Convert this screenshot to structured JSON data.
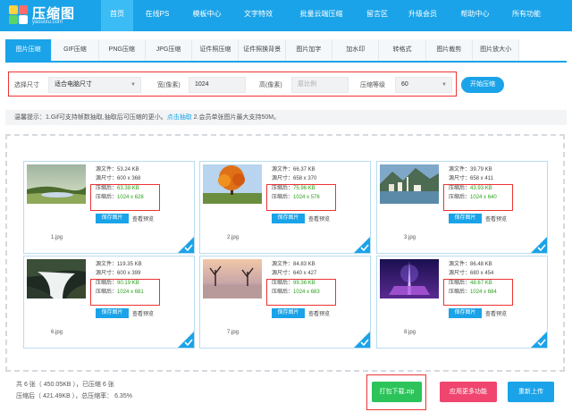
{
  "brand": {
    "name": "压缩图",
    "domain": "yasuotu.com"
  },
  "colors": {
    "primary": "#1aa3e8",
    "green": "#2ca01c",
    "pink": "#f0456f",
    "highlight": "#e33333"
  },
  "nav": [
    "首页",
    "在线PS",
    "模板中心",
    "文字特效",
    "批量云端压缩",
    "留言区",
    "升级会员",
    "帮助中心",
    "所有功能"
  ],
  "tabs": [
    "图片压缩",
    "GIF压缩",
    "PNG压缩",
    "JPG压缩",
    "证件照压缩",
    "证件照换背景",
    "图片加字",
    "加水印",
    "转格式",
    "图片裁剪",
    "图片放大小"
  ],
  "options": {
    "size_label": "选择尺寸",
    "size_value": "适合电脑尺寸",
    "width_label": "宽(像素)",
    "width_value": "1024",
    "height_label": "高(像素)",
    "height_placeholder": "原比例",
    "level_label": "压缩等级",
    "level_value": "60",
    "start_button": "开始压缩"
  },
  "tip": {
    "prefix": "温馨提示：1.Gif可支持帧数抽取,抽取后可压缩的更小。",
    "link": "点击抽取",
    "suffix": " 2.会员单张图片最大支持50M。"
  },
  "labels": {
    "src_size": "源文件：",
    "src_dim": "源尺寸：",
    "after_size": "压缩后：",
    "after_dim": "压缩后：",
    "save": "保存图片",
    "preview": "查看预览"
  },
  "images": [
    {
      "name": "1.jpg",
      "src_size": "53.24 KB",
      "src_dim": "600 x 368",
      "out_size": "63.38 KB",
      "out_dim": "1024 x 628"
    },
    {
      "name": "2.jpg",
      "src_size": "66.37 KB",
      "src_dim": "658 x 370",
      "out_size": "75.96 KB",
      "out_dim": "1024 x 576"
    },
    {
      "name": "3.jpg",
      "src_size": "39.79 KB",
      "src_dim": "658 x 411",
      "out_size": "43.93 KB",
      "out_dim": "1024 x 640"
    },
    {
      "name": "6.jpg",
      "src_size": "119.35 KB",
      "src_dim": "600 x 399",
      "out_size": "90.19 KB",
      "out_dim": "1024 x 681"
    },
    {
      "name": "7.jpg",
      "src_size": "84.83 KB",
      "src_dim": "640 x 427",
      "out_size": "99.36 KB",
      "out_dim": "1024 x 683"
    },
    {
      "name": "8.jpg",
      "src_size": "86.48 KB",
      "src_dim": "680 x 454",
      "out_size": "48.67 KB",
      "out_dim": "1024 x 684"
    }
  ],
  "footer": {
    "line1": "共 6 张（ 450.05KB ），已压缩 6 张",
    "line2": "压缩后（ 421.49KB ），总压缩率： 6.35%",
    "download": "打包下载.zip",
    "more": "应用更多功能",
    "reupload": "重新上传"
  }
}
